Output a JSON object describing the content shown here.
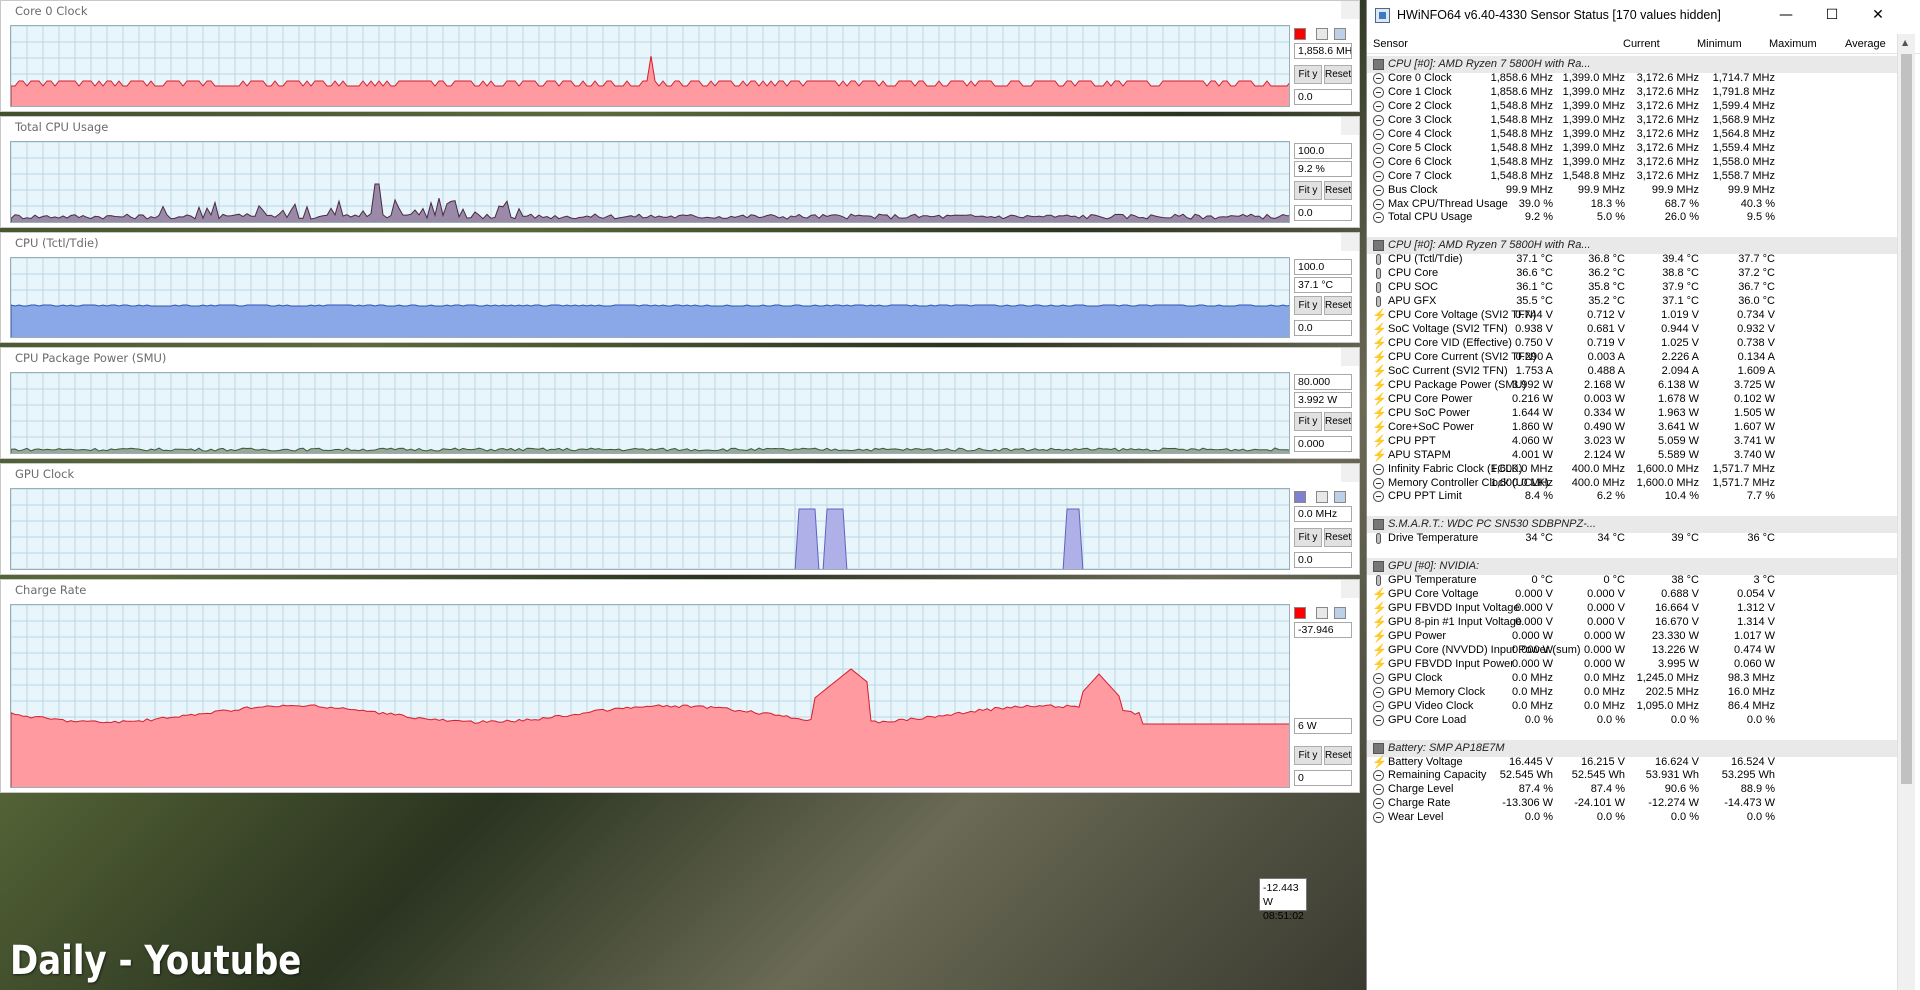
{
  "watermark": "Daily - Youtube",
  "graphs": [
    {
      "name": "core0-clock",
      "title": "Core 0 Clock",
      "top_value": "",
      "current": "1,858.6 MH",
      "bottom_value": "0.0",
      "color": "#ff9aa0",
      "line": "#d81c2a",
      "swatch": "#ff0000"
    },
    {
      "name": "total-cpu-usage",
      "title": "Total CPU Usage",
      "top_value": "100.0",
      "current": "9.2 %",
      "bottom_value": "0.0",
      "color": "#9a8aa8",
      "line": "#4a2a44",
      "swatch": ""
    },
    {
      "name": "cpu-tctl",
      "title": "CPU (Tctl/Tdie)",
      "top_value": "100.0",
      "current": "37.1 °C",
      "bottom_value": "0.0",
      "color": "#8aa8e8",
      "line": "#2a55b8",
      "swatch": ""
    },
    {
      "name": "cpu-package-power",
      "title": "CPU Package Power (SMU)",
      "top_value": "80.000",
      "current": "3.992 W",
      "bottom_value": "0.000",
      "color": "#9aa89a",
      "line": "#3a5a3a",
      "swatch": ""
    },
    {
      "name": "gpu-clock",
      "title": "GPU Clock",
      "top_value": "",
      "current": "0.0 MHz",
      "bottom_value": "0.0",
      "color": "#b0b0e8",
      "line": "#6060c0",
      "swatch": "#8080d0"
    },
    {
      "name": "charge-rate",
      "title": "Charge Rate",
      "top_value": "-37.946",
      "current": "6 W",
      "bottom_value": "0",
      "color": "#ff9aa0",
      "line": "#d81c2a",
      "swatch": "#ff0000"
    }
  ],
  "buttons": {
    "fit": "Fit y",
    "reset": "Reset"
  },
  "tooltip": {
    "value": "-12.443 W",
    "time": "08:51:02"
  },
  "hwinfo": {
    "title": "HWiNFO64 v6.40-4330 Sensor Status [170 values hidden]",
    "columns": [
      "Sensor",
      "Current",
      "Minimum",
      "Maximum",
      "Average"
    ],
    "rows": [
      {
        "g": "CPU [#0]: AMD Ryzen 7 5800H with Ra..."
      },
      {
        "i": "clock",
        "n": "Core 0 Clock",
        "v": [
          "1,858.6 MHz",
          "1,399.0 MHz",
          "3,172.6 MHz",
          "1,714.7 MHz"
        ]
      },
      {
        "i": "clock",
        "n": "Core 1 Clock",
        "v": [
          "1,858.6 MHz",
          "1,399.0 MHz",
          "3,172.6 MHz",
          "1,791.8 MHz"
        ]
      },
      {
        "i": "clock",
        "n": "Core 2 Clock",
        "v": [
          "1,548.8 MHz",
          "1,399.0 MHz",
          "3,172.6 MHz",
          "1,599.4 MHz"
        ]
      },
      {
        "i": "clock",
        "n": "Core 3 Clock",
        "v": [
          "1,548.8 MHz",
          "1,399.0 MHz",
          "3,172.6 MHz",
          "1,568.9 MHz"
        ]
      },
      {
        "i": "clock",
        "n": "Core 4 Clock",
        "v": [
          "1,548.8 MHz",
          "1,399.0 MHz",
          "3,172.6 MHz",
          "1,564.8 MHz"
        ]
      },
      {
        "i": "clock",
        "n": "Core 5 Clock",
        "v": [
          "1,548.8 MHz",
          "1,399.0 MHz",
          "3,172.6 MHz",
          "1,559.4 MHz"
        ]
      },
      {
        "i": "clock",
        "n": "Core 6 Clock",
        "v": [
          "1,548.8 MHz",
          "1,399.0 MHz",
          "3,172.6 MHz",
          "1,558.0 MHz"
        ]
      },
      {
        "i": "clock",
        "n": "Core 7 Clock",
        "v": [
          "1,548.8 MHz",
          "1,548.8 MHz",
          "3,172.6 MHz",
          "1,558.7 MHz"
        ]
      },
      {
        "i": "clock",
        "n": "Bus Clock",
        "v": [
          "99.9 MHz",
          "99.9 MHz",
          "99.9 MHz",
          "99.9 MHz"
        ]
      },
      {
        "i": "clock",
        "n": "Max CPU/Thread Usage",
        "v": [
          "39.0 %",
          "18.3 %",
          "68.7 %",
          "40.3 %"
        ]
      },
      {
        "i": "clock",
        "n": "Total CPU Usage",
        "v": [
          "9.2 %",
          "5.0 %",
          "26.0 %",
          "9.5 %"
        ]
      },
      {
        "blank": true
      },
      {
        "g": "CPU [#0]: AMD Ryzen 7 5800H with Ra..."
      },
      {
        "i": "temp",
        "n": "CPU (Tctl/Tdie)",
        "v": [
          "37.1 °C",
          "36.8 °C",
          "39.4 °C",
          "37.7 °C"
        ]
      },
      {
        "i": "temp",
        "n": "CPU Core",
        "v": [
          "36.6 °C",
          "36.2 °C",
          "38.8 °C",
          "37.2 °C"
        ]
      },
      {
        "i": "temp",
        "n": "CPU SOC",
        "v": [
          "36.1 °C",
          "35.8 °C",
          "37.9 °C",
          "36.7 °C"
        ]
      },
      {
        "i": "temp",
        "n": "APU GFX",
        "v": [
          "35.5 °C",
          "35.2 °C",
          "37.1 °C",
          "36.0 °C"
        ]
      },
      {
        "i": "volt",
        "n": "CPU Core Voltage (SVI2 TFN)",
        "v": [
          "0.744 V",
          "0.712 V",
          "1.019 V",
          "0.734 V"
        ]
      },
      {
        "i": "volt",
        "n": "SoC Voltage (SVI2 TFN)",
        "v": [
          "0.938 V",
          "0.681 V",
          "0.944 V",
          "0.932 V"
        ]
      },
      {
        "i": "volt",
        "n": "CPU Core VID (Effective)",
        "v": [
          "0.750 V",
          "0.719 V",
          "1.025 V",
          "0.738 V"
        ]
      },
      {
        "i": "volt",
        "n": "CPU Core Current (SVI2 TFN)",
        "v": [
          "0.290 A",
          "0.003 A",
          "2.226 A",
          "0.134 A"
        ]
      },
      {
        "i": "volt",
        "n": "SoC Current (SVI2 TFN)",
        "v": [
          "1.753 A",
          "0.488 A",
          "2.094 A",
          "1.609 A"
        ]
      },
      {
        "i": "volt",
        "n": "CPU Package Power (SMU)",
        "v": [
          "3.992 W",
          "2.168 W",
          "6.138 W",
          "3.725 W"
        ]
      },
      {
        "i": "volt",
        "n": "CPU Core Power",
        "v": [
          "0.216 W",
          "0.003 W",
          "1.678 W",
          "0.102 W"
        ]
      },
      {
        "i": "volt",
        "n": "CPU SoC Power",
        "v": [
          "1.644 W",
          "0.334 W",
          "1.963 W",
          "1.505 W"
        ]
      },
      {
        "i": "volt",
        "n": "Core+SoC Power",
        "v": [
          "1.860 W",
          "0.490 W",
          "3.641 W",
          "1.607 W"
        ]
      },
      {
        "i": "volt",
        "n": "CPU PPT",
        "v": [
          "4.060 W",
          "3.023 W",
          "5.059 W",
          "3.741 W"
        ]
      },
      {
        "i": "volt",
        "n": "APU STAPM",
        "v": [
          "4.001 W",
          "2.124 W",
          "5.589 W",
          "3.740 W"
        ]
      },
      {
        "i": "clock",
        "n": "Infinity Fabric Clock (FCLK)",
        "v": [
          "1,600.0 MHz",
          "400.0 MHz",
          "1,600.0 MHz",
          "1,571.7 MHz"
        ]
      },
      {
        "i": "clock",
        "n": "Memory Controller Clock (UCLK)",
        "v": [
          "1,600.0 MHz",
          "400.0 MHz",
          "1,600.0 MHz",
          "1,571.7 MHz"
        ]
      },
      {
        "i": "clock",
        "n": "CPU PPT Limit",
        "v": [
          "8.4 %",
          "6.2 %",
          "10.4 %",
          "7.7 %"
        ]
      },
      {
        "blank": true
      },
      {
        "g": "S.M.A.R.T.: WDC PC SN530 SDBPNPZ-..."
      },
      {
        "i": "temp",
        "n": "Drive Temperature",
        "v": [
          "34 °C",
          "34 °C",
          "39 °C",
          "36 °C"
        ]
      },
      {
        "blank": true
      },
      {
        "g": "GPU [#0]: NVIDIA:"
      },
      {
        "i": "temp",
        "n": "GPU Temperature",
        "v": [
          "0 °C",
          "0 °C",
          "38 °C",
          "3 °C"
        ]
      },
      {
        "i": "volt",
        "n": "GPU Core Voltage",
        "v": [
          "0.000 V",
          "0.000 V",
          "0.688 V",
          "0.054 V"
        ]
      },
      {
        "i": "volt",
        "n": "GPU FBVDD Input Voltage",
        "v": [
          "0.000 V",
          "0.000 V",
          "16.664 V",
          "1.312 V"
        ]
      },
      {
        "i": "volt",
        "n": "GPU 8-pin #1 Input Voltage",
        "v": [
          "0.000 V",
          "0.000 V",
          "16.670 V",
          "1.314 V"
        ]
      },
      {
        "i": "volt",
        "n": "GPU Power",
        "v": [
          "0.000 W",
          "0.000 W",
          "23.330 W",
          "1.017 W"
        ]
      },
      {
        "i": "volt",
        "n": "GPU Core (NVVDD) Input Power (sum)",
        "v": [
          "0.000 W",
          "0.000 W",
          "13.226 W",
          "0.474 W"
        ]
      },
      {
        "i": "volt",
        "n": "GPU FBVDD Input Power",
        "v": [
          "0.000 W",
          "0.000 W",
          "3.995 W",
          "0.060 W"
        ]
      },
      {
        "i": "clock",
        "n": "GPU Clock",
        "v": [
          "0.0 MHz",
          "0.0 MHz",
          "1,245.0 MHz",
          "98.3 MHz"
        ]
      },
      {
        "i": "clock",
        "n": "GPU Memory Clock",
        "v": [
          "0.0 MHz",
          "0.0 MHz",
          "202.5 MHz",
          "16.0 MHz"
        ]
      },
      {
        "i": "clock",
        "n": "GPU Video Clock",
        "v": [
          "0.0 MHz",
          "0.0 MHz",
          "1,095.0 MHz",
          "86.4 MHz"
        ]
      },
      {
        "i": "clock",
        "n": "GPU Core Load",
        "v": [
          "0.0 %",
          "0.0 %",
          "0.0 %",
          "0.0 %"
        ]
      },
      {
        "blank": true
      },
      {
        "g": "Battery: SMP AP18E7M"
      },
      {
        "i": "volt",
        "n": "Battery Voltage",
        "v": [
          "16.445 V",
          "16.215 V",
          "16.624 V",
          "16.524 V"
        ]
      },
      {
        "i": "clock",
        "n": "Remaining Capacity",
        "v": [
          "52.545 Wh",
          "52.545 Wh",
          "53.931 Wh",
          "53.295 Wh"
        ]
      },
      {
        "i": "clock",
        "n": "Charge Level",
        "v": [
          "87.4 %",
          "87.4 %",
          "90.6 %",
          "88.9 %"
        ]
      },
      {
        "i": "clock",
        "n": "Charge Rate",
        "v": [
          "-13.306 W",
          "-24.101 W",
          "-12.274 W",
          "-14.473 W"
        ]
      },
      {
        "i": "clock",
        "n": "Wear Level",
        "v": [
          "0.0 %",
          "0.0 %",
          "0.0 %",
          "0.0 %"
        ]
      }
    ]
  }
}
